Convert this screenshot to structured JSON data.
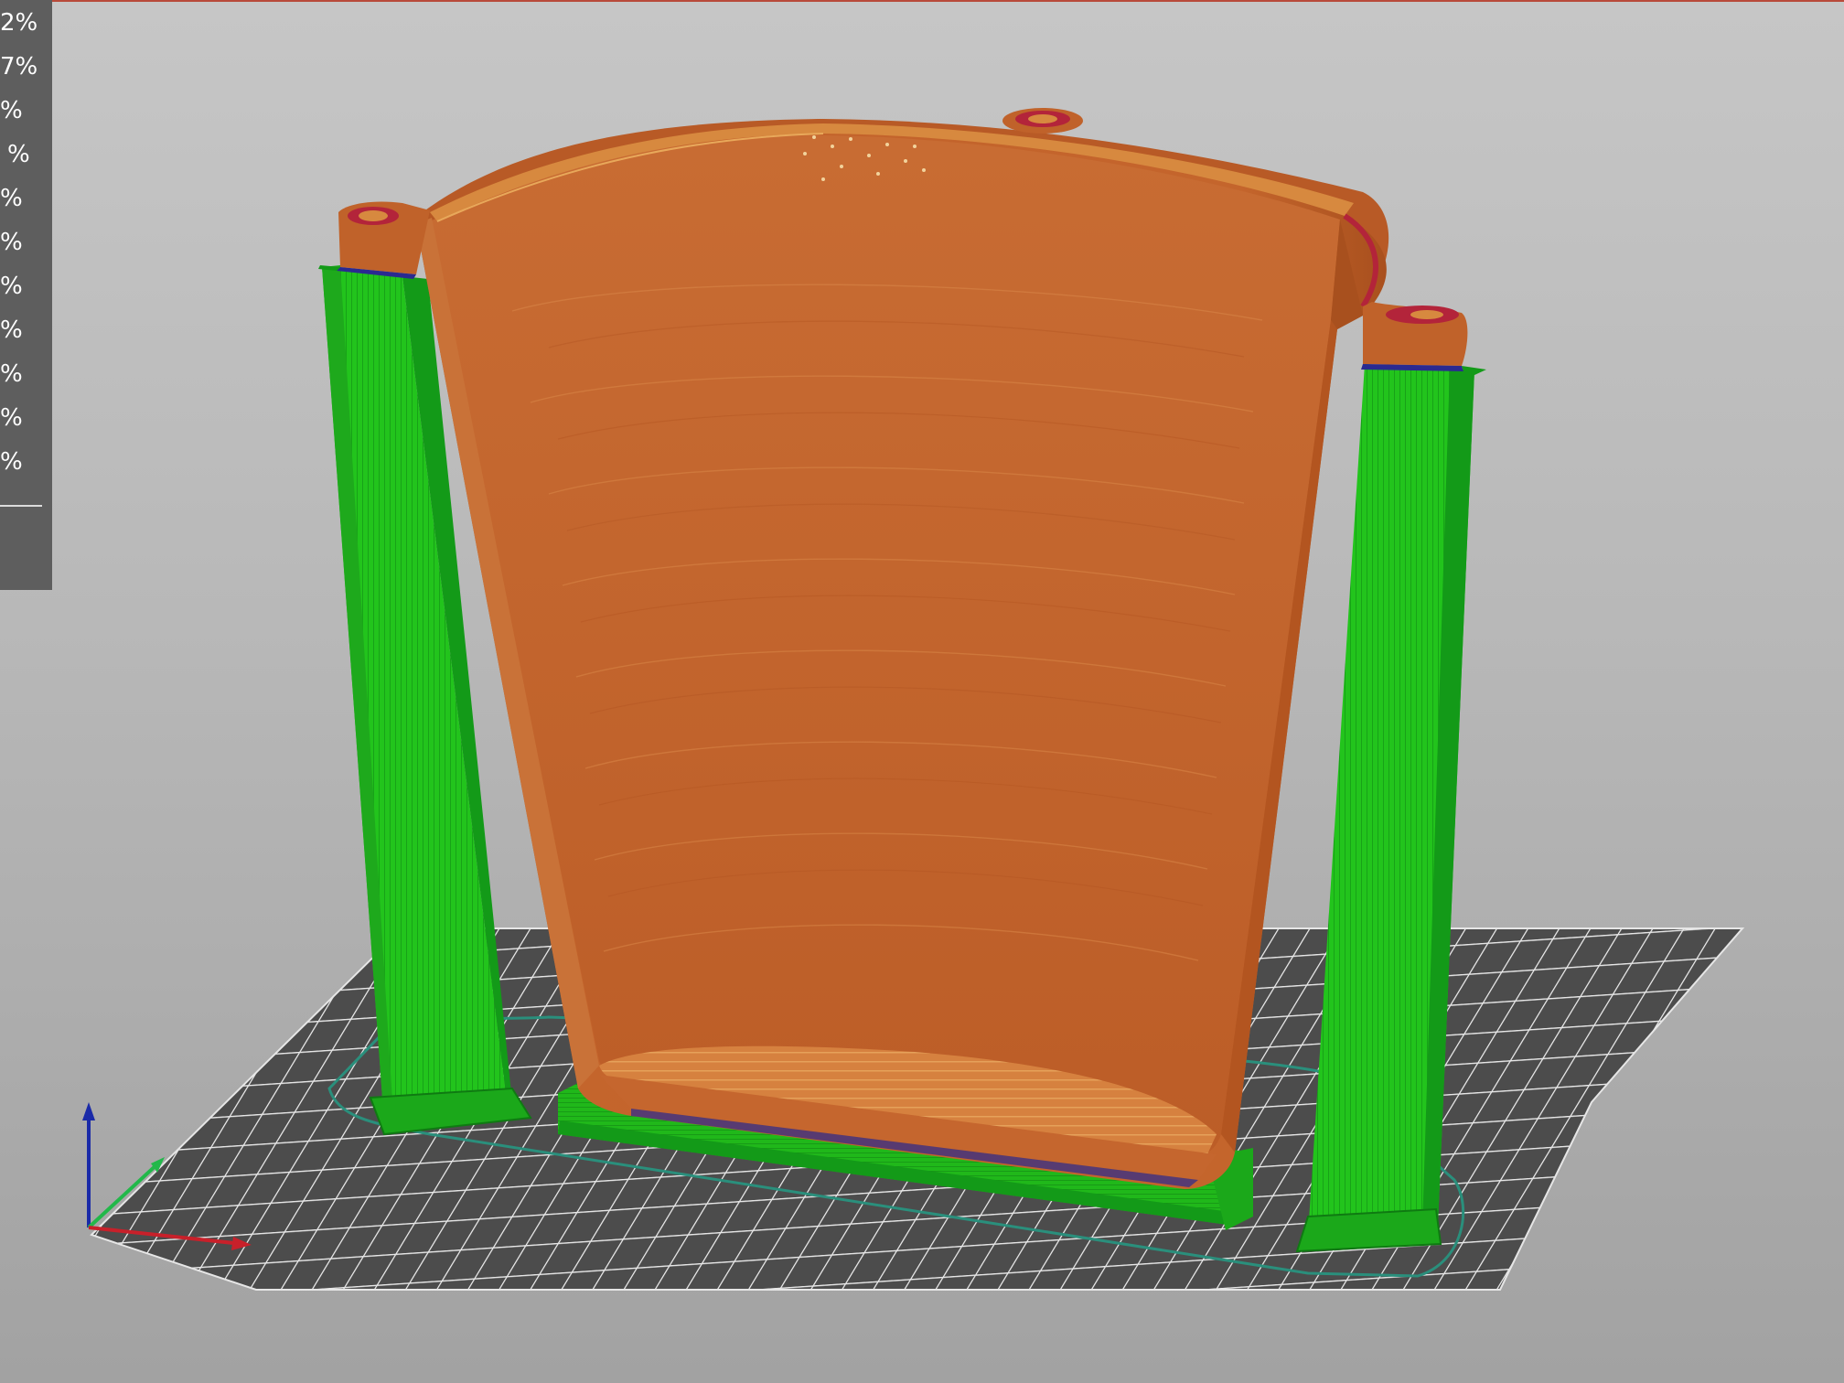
{
  "viewport": {
    "background_top": "#c6c6c6",
    "background_bottom": "#a2a2a2"
  },
  "legend": {
    "items": [
      {
        "label": "2%"
      },
      {
        "label": "7%"
      },
      {
        "label": "%"
      },
      {
        "label": "%"
      },
      {
        "label": "%"
      },
      {
        "label": "%"
      },
      {
        "label": "%"
      },
      {
        "label": "%"
      },
      {
        "label": "%"
      },
      {
        "label": "%"
      },
      {
        "label": "%"
      }
    ],
    "panel_color": "#5e5e5e"
  },
  "model": {
    "body_color": "#c0622a",
    "body_dark": "#a8501e",
    "support_color": "#22c41c",
    "support_dark": "#13921a",
    "perimeter_red": "#b3243a",
    "bed_color": "#505050",
    "bed_grid_color": "#e6e6e6",
    "skirt_color": "#2a8f7c"
  },
  "axes": {
    "x_color": "#c8202a",
    "y_color": "#22b84a",
    "z_color": "#1a2aa8"
  }
}
